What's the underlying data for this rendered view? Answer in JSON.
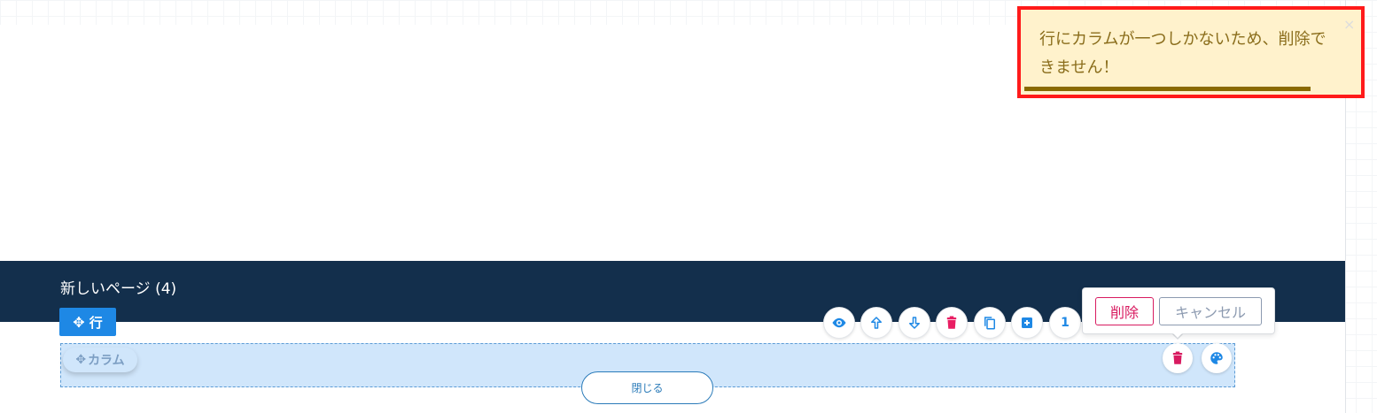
{
  "page": {
    "title": "新しいページ (4)"
  },
  "row_tag": {
    "label": "行"
  },
  "column_tag": {
    "label": "カラム"
  },
  "toolbar": {
    "items": [
      {
        "icon": "eye-icon"
      },
      {
        "icon": "arrow-up-icon"
      },
      {
        "icon": "arrow-down-icon"
      },
      {
        "icon": "trash-icon"
      },
      {
        "icon": "copy-icon"
      },
      {
        "icon": "plus-square-icon"
      },
      {
        "icon": "number-badge",
        "text": "1"
      }
    ]
  },
  "column_actions": [
    {
      "icon": "trash-icon"
    },
    {
      "icon": "palette-icon"
    }
  ],
  "close_button": {
    "label": "閉じる"
  },
  "confirm": {
    "delete_label": "削除",
    "cancel_label": "キャンセル"
  },
  "toast": {
    "message": "行にカラムが一つしかないため、削除できません！",
    "close_symbol": "×",
    "progress": 0.84
  },
  "colors": {
    "accent": "#1e88e5",
    "header_bg": "#132f4c",
    "danger": "#d81b60",
    "toast_bg": "#fff2cc",
    "toast_border": "#ff1a1a"
  }
}
